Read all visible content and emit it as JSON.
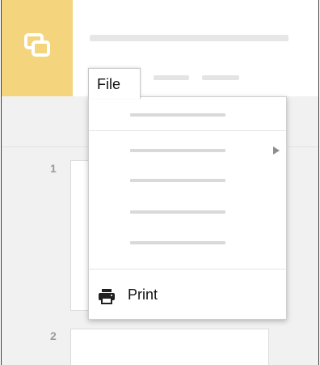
{
  "menubar": {
    "active_menu": "File"
  },
  "file_menu": {
    "print_label": "Print"
  },
  "slides": {
    "numbers": [
      "1",
      "2"
    ]
  },
  "icons": {
    "app_logo": "slides-logo-icon",
    "submenu": "submenu-arrow-icon",
    "print": "printer-icon"
  },
  "colors": {
    "logo_background": "#f4d57d",
    "logo_foreground": "#ffffff"
  }
}
